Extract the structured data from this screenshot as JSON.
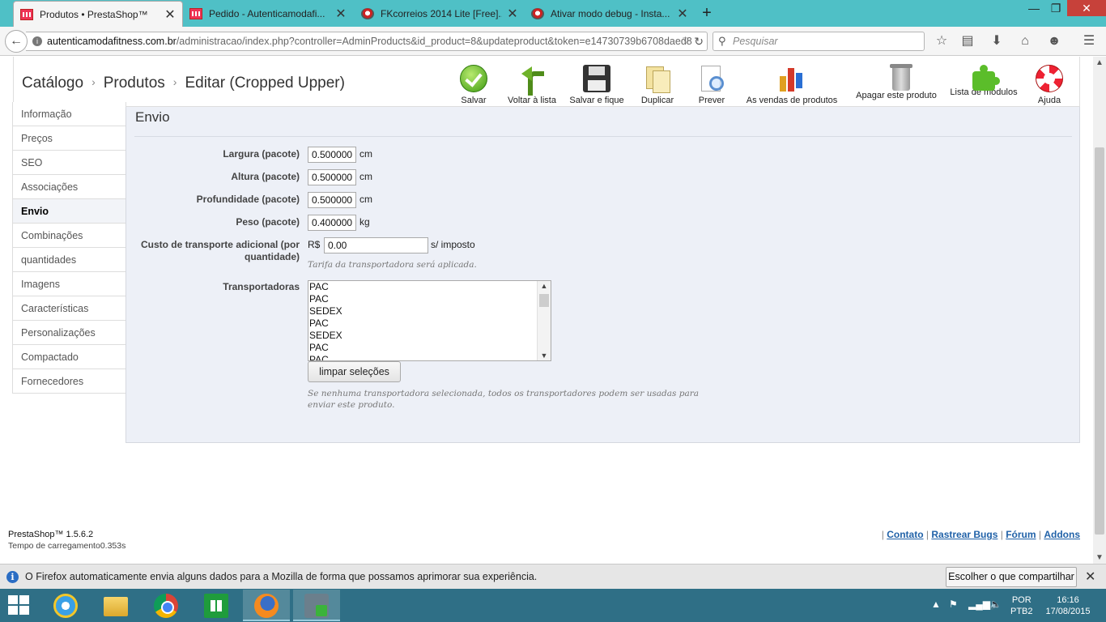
{
  "browser": {
    "tabs": [
      {
        "title": "Produtos • PrestaShop™",
        "active": true
      },
      {
        "title": "Pedido - Autenticamodafi...",
        "active": false
      },
      {
        "title": "FKcorreios 2014 Lite [Free]...",
        "active": false
      },
      {
        "title": "Ativar modo debug - Insta...",
        "active": false
      }
    ],
    "new_tab_symbol": "+",
    "url_host": "autenticamodafitness.com.br",
    "url_path": "/administracao/index.php?controller=AdminProducts&id_product=8&updateproduct&token=e14730739b6708daed8",
    "search_placeholder": "Pesquisar"
  },
  "header": {
    "breadcrumb": [
      "Catálogo",
      "Produtos",
      "Editar (Cropped Upper)"
    ],
    "breadcrumb_separator": "›",
    "toolbar": [
      {
        "label": "Salvar",
        "icon": "save-check-icon"
      },
      {
        "label": "Voltar à lista",
        "icon": "back-arrow-icon"
      },
      {
        "label": "Salvar e fique",
        "icon": "floppy-disk-icon"
      },
      {
        "label": "Duplicar",
        "icon": "duplicate-icon"
      },
      {
        "label": "Prever",
        "icon": "preview-icon"
      },
      {
        "label": "As vendas de produtos",
        "icon": "sales-chart-icon"
      },
      {
        "label": "Apagar este produto",
        "icon": "trash-icon"
      },
      {
        "label": "Lista de módulos",
        "icon": "puzzle-icon"
      },
      {
        "label": "Ajuda",
        "icon": "help-lifebuoy-icon"
      }
    ]
  },
  "sidebar": {
    "items": [
      {
        "label": "Informação",
        "active": false
      },
      {
        "label": "Preços",
        "active": false
      },
      {
        "label": "SEO",
        "active": false
      },
      {
        "label": "Associações",
        "active": false
      },
      {
        "label": "Envio",
        "active": true
      },
      {
        "label": "Combinações",
        "active": false
      },
      {
        "label": "quantidades",
        "active": false
      },
      {
        "label": "Imagens",
        "active": false
      },
      {
        "label": "Características",
        "active": false
      },
      {
        "label": "Personalizações",
        "active": false
      },
      {
        "label": "Compactado",
        "active": false
      },
      {
        "label": "Fornecedores",
        "active": false
      }
    ]
  },
  "form": {
    "title": "Envio",
    "width": {
      "label": "Largura (pacote)",
      "value": "0.500000",
      "unit": "cm"
    },
    "height": {
      "label": "Altura (pacote)",
      "value": "0.500000",
      "unit": "cm"
    },
    "depth": {
      "label": "Profundidade (pacote)",
      "value": "0.500000",
      "unit": "cm"
    },
    "weight": {
      "label": "Peso (pacote)",
      "value": "0.400000",
      "unit": "kg"
    },
    "extra_shipping": {
      "label": "Custo de transporte adicional (por quantidade)",
      "currency": "R$",
      "value": "0.00",
      "suffix": "s/ imposto",
      "hint": "Tarifa da transportadora será aplicada."
    },
    "carriers": {
      "label": "Transportadoras",
      "options": [
        "PAC",
        "PAC",
        "SEDEX",
        "PAC",
        "SEDEX",
        "PAC",
        "PAC"
      ],
      "clear_button": "limpar seleções",
      "hint": "Se nenhuma transportadora selecionada, todos os transportadores podem ser usadas para enviar este produto."
    }
  },
  "footer": {
    "version": "PrestaShop™ 1.5.6.2",
    "load_time": "Tempo de carregamento0.353s",
    "links": [
      "Contato",
      "Rastrear Bugs",
      "Fórum",
      "Addons"
    ]
  },
  "notification": {
    "text": "O Firefox automaticamente envia alguns dados para a Mozilla de forma que possamos aprimorar sua experiência.",
    "button": "Escolher o que compartilhar"
  },
  "taskbar": {
    "language_line1": "POR",
    "language_line2": "PTB2",
    "time": "16:16",
    "date": "17/08/2015"
  },
  "colors": {
    "tabbar": "#4fc0c6",
    "panel_bg": "#edf0f7",
    "link": "#2162a8",
    "taskbar": "#2f6f86"
  }
}
